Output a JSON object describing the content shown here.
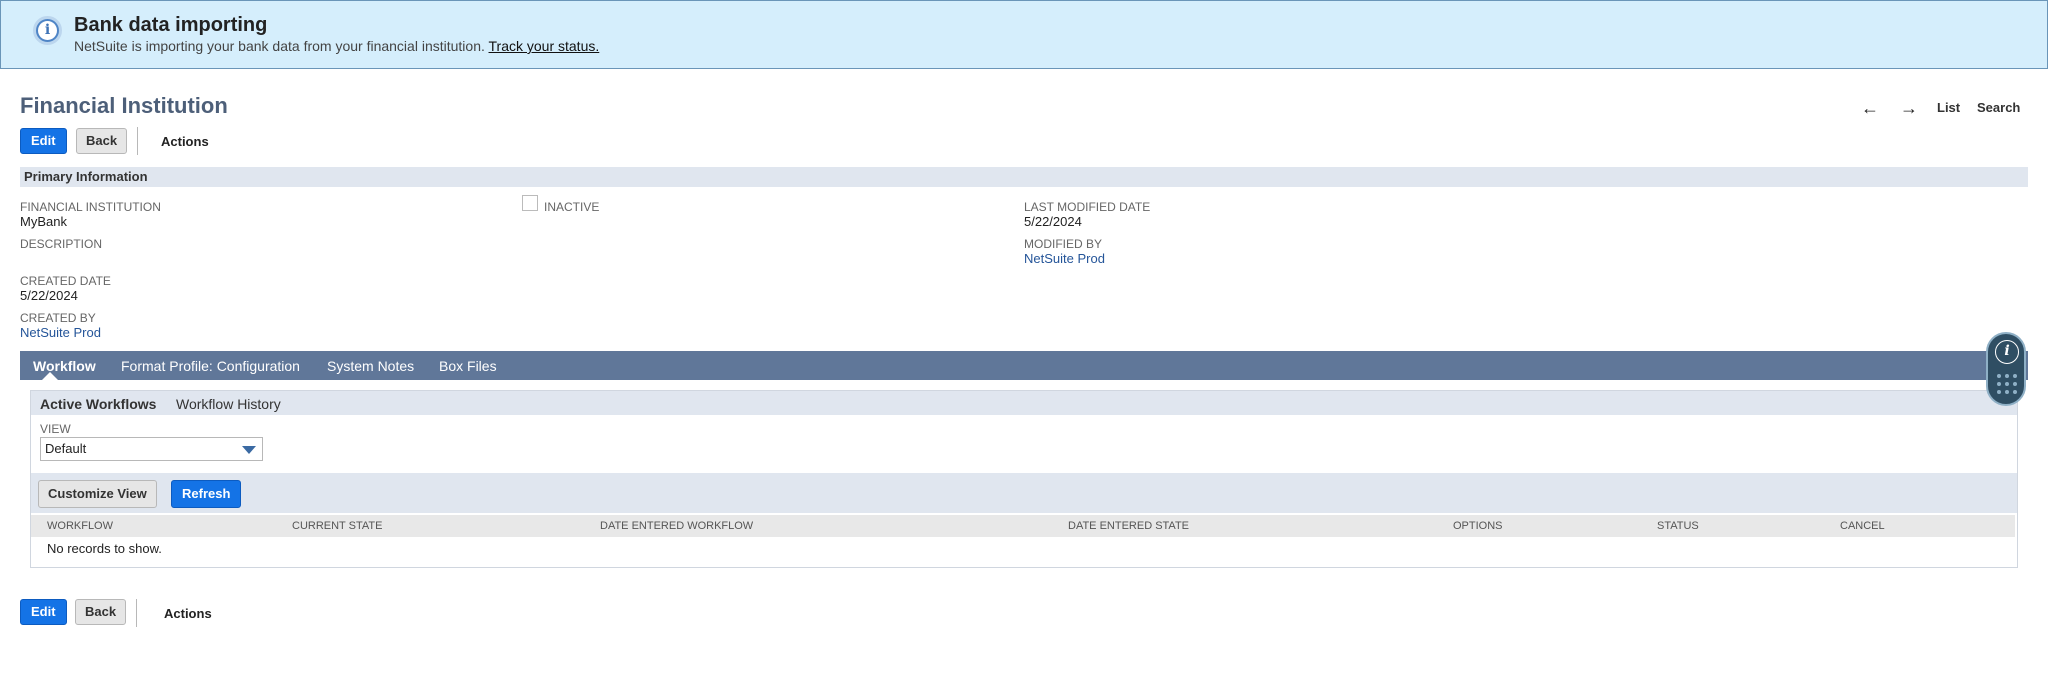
{
  "banner": {
    "title": "Bank data importing",
    "text": "NetSuite is importing your bank data from your financial institution.",
    "link": "Track your status.",
    "icon": "info-icon"
  },
  "header": {
    "title": "Financial Institution",
    "prev_arrow": "←",
    "next_arrow": "→",
    "list_label": "List",
    "search_label": "Search"
  },
  "buttons": {
    "edit": "Edit",
    "back": "Back",
    "actions": "Actions"
  },
  "primary": {
    "section_title": "Primary Information",
    "financial_institution_label": "FINANCIAL INSTITUTION",
    "financial_institution_value": "MyBank",
    "description_label": "DESCRIPTION",
    "created_date_label": "CREATED DATE",
    "created_date_value": "5/22/2024",
    "created_by_label": "CREATED BY",
    "created_by_value": "NetSuite Prod",
    "inactive_label": "INACTIVE",
    "last_modified_label": "LAST MODIFIED DATE",
    "last_modified_value": "5/22/2024",
    "modified_by_label": "MODIFIED BY",
    "modified_by_value": "NetSuite Prod"
  },
  "tabs": [
    {
      "label": "Workflow"
    },
    {
      "label": "Format Profile: Configuration"
    },
    {
      "label": "System Notes"
    },
    {
      "label": "Box Files"
    }
  ],
  "subtabs": [
    {
      "label": "Active Workflows"
    },
    {
      "label": "Workflow History"
    }
  ],
  "view": {
    "label": "VIEW",
    "selected": "Default"
  },
  "toolbar": {
    "customize_label": "Customize View",
    "refresh_label": "Refresh"
  },
  "grid": {
    "columns": [
      "WORKFLOW",
      "CURRENT STATE",
      "DATE ENTERED WORKFLOW",
      "DATE ENTERED STATE",
      "OPTIONS",
      "STATUS",
      "CANCEL"
    ],
    "empty_text": "No records to show."
  },
  "widget": {
    "info_icon": "info-icon",
    "grid_icon": "dots-grid-icon",
    "info_glyph": "i"
  },
  "colors": {
    "banner_bg": "#d5eefc",
    "primary_button": "#1473e6",
    "tabbar": "#607799",
    "title": "#4d5f79",
    "link": "#255599"
  }
}
